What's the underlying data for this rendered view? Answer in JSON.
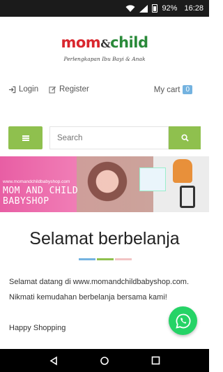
{
  "status": {
    "battery_percent": "92%",
    "time": "16:28"
  },
  "logo": {
    "part1": "mom",
    "amp": "&",
    "part2": "child",
    "tagline": "Perlengkapan Ibu Bayi & Anak"
  },
  "userbar": {
    "login_label": "Login",
    "register_label": "Register",
    "cart_label": "My cart",
    "cart_count": "0"
  },
  "search": {
    "placeholder": "Search"
  },
  "banner": {
    "url_text": "www.momandchildbabyshop.com",
    "title_line1": "MOM AND CHILD",
    "title_line2": "BABYSHOP"
  },
  "welcome": {
    "title": "Selamat berbelanja",
    "paragraph1": "Selamat datang di www.momandchildbabyshop.com. Nikmati kemudahan berbelanja bersama kami!",
    "paragraph2": "Happy Shopping"
  },
  "colors": {
    "accent_green": "#8fc04e",
    "divider_blue": "#74b3e0",
    "divider_green": "#8fc04e",
    "divider_pink": "#f2c4c4",
    "whatsapp": "#25d366"
  },
  "icons": [
    "wifi-icon",
    "signal-icon",
    "battery-icon",
    "login-icon",
    "register-icon",
    "menu-icon",
    "search-icon",
    "whatsapp-icon",
    "nav-back-icon",
    "nav-home-icon",
    "nav-recents-icon"
  ]
}
